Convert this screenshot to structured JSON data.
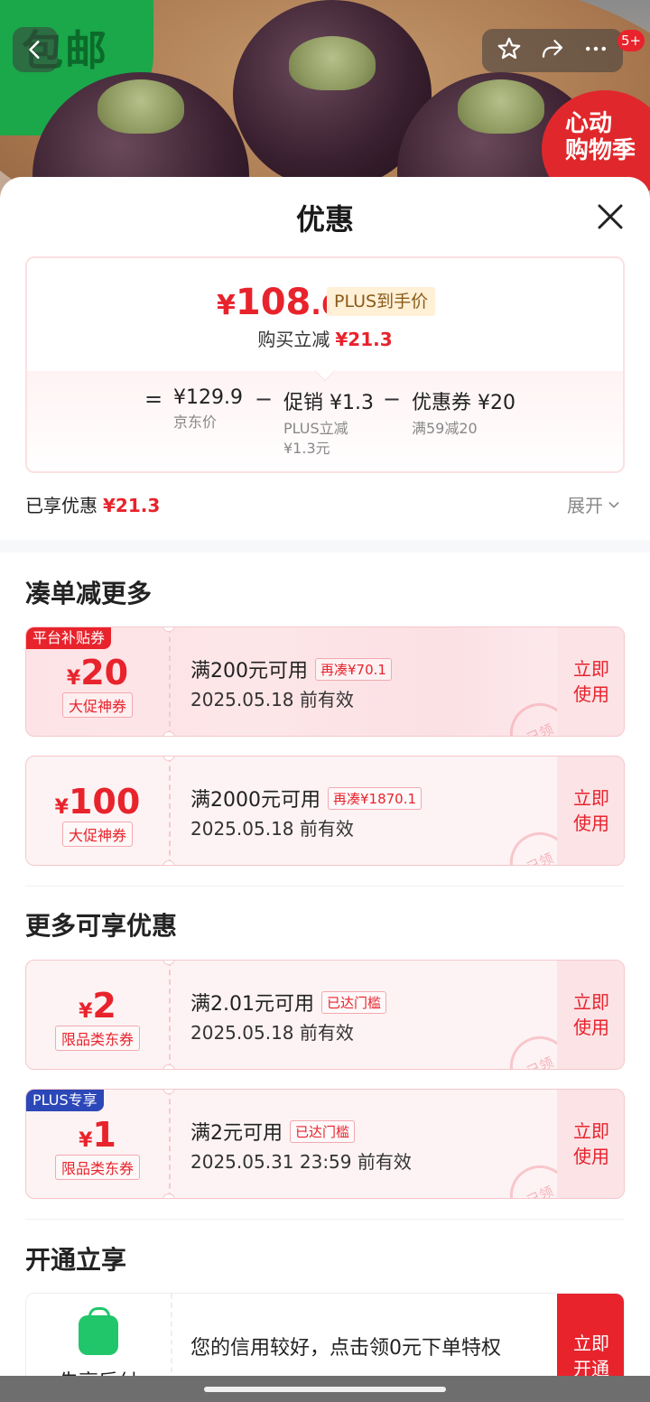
{
  "hero": {
    "promo_text": "包邮",
    "badge_text": "心动购物季",
    "notification_count": "5+"
  },
  "sheet": {
    "title": "优惠"
  },
  "summary": {
    "price_symbol": "¥",
    "price_integer": "108",
    "price_decimal": ".6",
    "plus_label": "PLUS到手价",
    "reduce_label": "购买立减",
    "reduce_amount": "¥21.3",
    "breakdown": [
      {
        "op": "=",
        "value": "¥129.9",
        "sub": "京东价"
      },
      {
        "op": "−",
        "value": "促销 ¥1.3",
        "sub": "PLUS立减\n¥1.3元"
      },
      {
        "op": "−",
        "value": "优惠券 ¥20",
        "sub": "满59减20"
      }
    ]
  },
  "enjoyed": {
    "label": "已享优惠",
    "amount": "¥21.3",
    "expand_label": "展开"
  },
  "section_more_items": {
    "title": "凑单减更多",
    "coupons": [
      {
        "tag": "平台补贴券",
        "symbol": "¥",
        "amount": "20",
        "kind": "大促神券",
        "condition": "满200元可用",
        "pill": "再凑¥70.1",
        "date": "2025.05.18 前有效",
        "use": "立即使用",
        "stamp": "已领"
      },
      {
        "tag": "",
        "symbol": "¥",
        "amount": "100",
        "kind": "大促神券",
        "condition": "满2000元可用",
        "pill": "再凑¥1870.1",
        "date": "2025.05.18 前有效",
        "use": "立即使用",
        "stamp": "已领"
      }
    ]
  },
  "section_more_offers": {
    "title": "更多可享优惠",
    "coupons": [
      {
        "tag": "",
        "symbol": "¥",
        "amount": "2",
        "kind": "限品类东券",
        "condition": "满2.01元可用",
        "pill": "已达门槛",
        "date": "2025.05.18 前有效",
        "use": "立即使用",
        "stamp": "已领"
      },
      {
        "tag": "PLUS专享",
        "symbol": "¥",
        "amount": "1",
        "kind": "限品类东券",
        "condition": "满2元可用",
        "pill": "已达门槛",
        "date": "2025.05.31 23:59 前有效",
        "use": "立即使用",
        "stamp": "已领"
      }
    ]
  },
  "section_open": {
    "title": "开通立享",
    "card_label": "先享后付",
    "card_text": "您的信用较好，点击领0元下单特权",
    "card_button": "立即开通"
  },
  "colors": {
    "accent_red": "#e8232c",
    "plus_blue": "#2b47b8",
    "subsidy_red": "#e8232c",
    "credit_green": "#21c56a"
  }
}
